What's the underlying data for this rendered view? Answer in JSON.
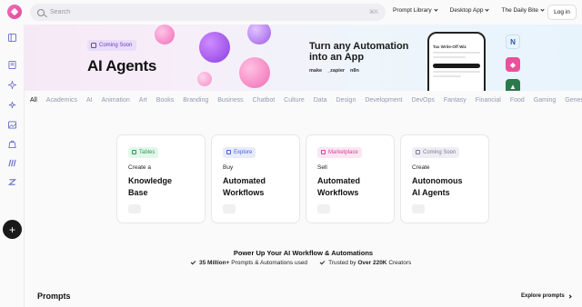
{
  "search": {
    "placeholder": "Search",
    "shortcut": "⌘K"
  },
  "topnav": [
    {
      "label": "Prompt Library"
    },
    {
      "label": "Desktop App"
    },
    {
      "label": "The Daily Bite"
    }
  ],
  "login_label": "Log in",
  "sidebar_icons": [
    "sidebar-panel-icon",
    "book-icon",
    "sparkle-icon",
    "sparkle-small-icon",
    "image-icon",
    "bag-icon",
    "make-icon",
    "zapier-icon"
  ],
  "banner": {
    "badge": "Coming Soon",
    "title": "AI Agents",
    "subtitle": "Turn any Automation into an App",
    "brands": [
      "make",
      "_zapier",
      "n8n"
    ],
    "phone_title": "Tax Write-Off Wiz"
  },
  "categories": [
    "All",
    "Academics",
    "AI",
    "Animation",
    "Art",
    "Books",
    "Branding",
    "Business",
    "Chatbot",
    "Culture",
    "Data",
    "Design",
    "Development",
    "DevOps",
    "Fantasy",
    "Financial",
    "Food",
    "Gaming",
    "Genera"
  ],
  "cards": [
    {
      "tag": "Tables",
      "tag_color": "#2e9b57",
      "tag_bg": "#e3f6ea",
      "lead": "Create a",
      "main1": "Knowledge",
      "main2": "Base"
    },
    {
      "tag": "Explore",
      "tag_color": "#4a63d8",
      "tag_bg": "#e7ebfb",
      "lead": "Buy",
      "main1": "Automated",
      "main2": "Workflows"
    },
    {
      "tag": "Marketplace",
      "tag_color": "#d4459a",
      "tag_bg": "#fbe6f2",
      "lead": "Sell",
      "main1": "Automated",
      "main2": "Workflows"
    },
    {
      "tag": "Coming Soon",
      "tag_color": "#7d7d9a",
      "tag_bg": "#eeeef4",
      "lead": "Create",
      "main1": "Autonomous",
      "main2": "AI Agents"
    }
  ],
  "power": {
    "title": "Power Up Your AI Workflow & Automations",
    "stat1_bold": "35 Million+",
    "stat1_rest": " Prompts & Automations used",
    "stat2_pre": "Trusted by ",
    "stat2_bold": "Over 220K",
    "stat2_rest": " Creators"
  },
  "prompts": {
    "title": "Prompts",
    "explore": "Explore prompts"
  },
  "colors": {
    "brand": "#e04d9a",
    "accent": "#6a6ac8"
  }
}
